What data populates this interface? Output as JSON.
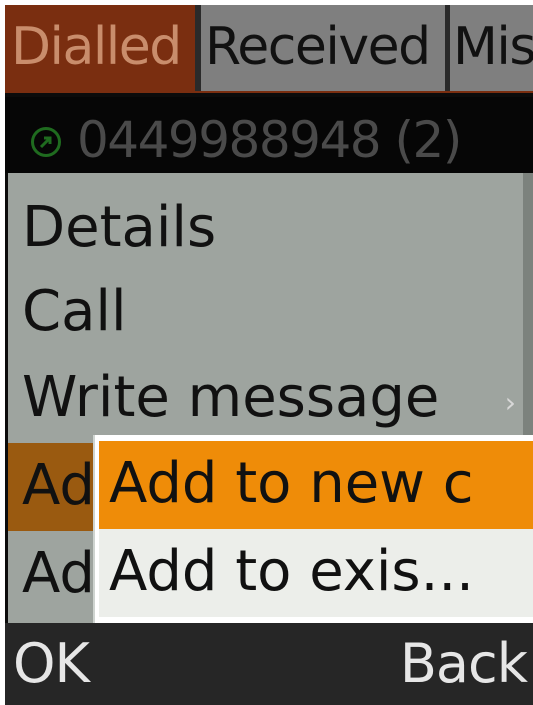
{
  "tabs": [
    {
      "label": "Dialled",
      "active": true
    },
    {
      "label": "Received",
      "active": false
    },
    {
      "label": "Mis",
      "active": false
    }
  ],
  "call_log": {
    "number": "0449988948 (2)",
    "icon": "outgoing-call-icon"
  },
  "menu": {
    "items": [
      {
        "label": "Details"
      },
      {
        "label": "Call"
      },
      {
        "label": "Write message",
        "has_submenu": true
      },
      {
        "label": "Add",
        "selected": true
      },
      {
        "label": "Ad"
      }
    ]
  },
  "submenu": {
    "items": [
      {
        "label": "Add to new c",
        "selected": true
      },
      {
        "label": "Add to exis..."
      }
    ]
  },
  "softkeys": {
    "left": "OK",
    "right": "Back"
  },
  "colors": {
    "active_tab": "#7a2e10",
    "menu_bg": "#9ea49f",
    "highlight": "#ef8c08"
  }
}
